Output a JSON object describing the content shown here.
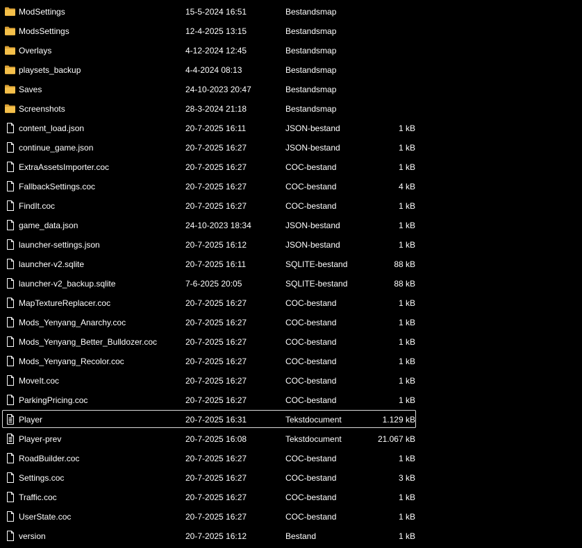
{
  "files": [
    {
      "name": "ModSettings",
      "date": "15-5-2024 16:51",
      "type": "Bestandsmap",
      "size": "",
      "icon": "folder-icon",
      "selected": false
    },
    {
      "name": "ModsSettings",
      "date": "12-4-2025 13:15",
      "type": "Bestandsmap",
      "size": "",
      "icon": "folder-icon",
      "selected": false
    },
    {
      "name": "Overlays",
      "date": "4-12-2024 12:45",
      "type": "Bestandsmap",
      "size": "",
      "icon": "folder-icon",
      "selected": false
    },
    {
      "name": "playsets_backup",
      "date": "4-4-2024 08:13",
      "type": "Bestandsmap",
      "size": "",
      "icon": "folder-icon",
      "selected": false
    },
    {
      "name": "Saves",
      "date": "24-10-2023 20:47",
      "type": "Bestandsmap",
      "size": "",
      "icon": "folder-icon",
      "selected": false
    },
    {
      "name": "Screenshots",
      "date": "28-3-2024 21:18",
      "type": "Bestandsmap",
      "size": "",
      "icon": "folder-icon",
      "selected": false
    },
    {
      "name": "content_load.json",
      "date": "20-7-2025 16:11",
      "type": "JSON-bestand",
      "size": "1 kB",
      "icon": "file-icon",
      "selected": false
    },
    {
      "name": "continue_game.json",
      "date": "20-7-2025 16:27",
      "type": "JSON-bestand",
      "size": "1 kB",
      "icon": "file-icon",
      "selected": false
    },
    {
      "name": "ExtraAssetsImporter.coc",
      "date": "20-7-2025 16:27",
      "type": "COC-bestand",
      "size": "1 kB",
      "icon": "file-icon",
      "selected": false
    },
    {
      "name": "FallbackSettings.coc",
      "date": "20-7-2025 16:27",
      "type": "COC-bestand",
      "size": "4 kB",
      "icon": "file-icon",
      "selected": false
    },
    {
      "name": "FindIt.coc",
      "date": "20-7-2025 16:27",
      "type": "COC-bestand",
      "size": "1 kB",
      "icon": "file-icon",
      "selected": false
    },
    {
      "name": "game_data.json",
      "date": "24-10-2023 18:34",
      "type": "JSON-bestand",
      "size": "1 kB",
      "icon": "file-icon",
      "selected": false
    },
    {
      "name": "launcher-settings.json",
      "date": "20-7-2025 16:12",
      "type": "JSON-bestand",
      "size": "1 kB",
      "icon": "file-icon",
      "selected": false
    },
    {
      "name": "launcher-v2.sqlite",
      "date": "20-7-2025 16:11",
      "type": "SQLITE-bestand",
      "size": "88 kB",
      "icon": "file-icon",
      "selected": false
    },
    {
      "name": "launcher-v2_backup.sqlite",
      "date": "7-6-2025 20:05",
      "type": "SQLITE-bestand",
      "size": "88 kB",
      "icon": "file-icon",
      "selected": false
    },
    {
      "name": "MapTextureReplacer.coc",
      "date": "20-7-2025 16:27",
      "type": "COC-bestand",
      "size": "1 kB",
      "icon": "file-icon",
      "selected": false
    },
    {
      "name": "Mods_Yenyang_Anarchy.coc",
      "date": "20-7-2025 16:27",
      "type": "COC-bestand",
      "size": "1 kB",
      "icon": "file-icon",
      "selected": false
    },
    {
      "name": "Mods_Yenyang_Better_Bulldozer.coc",
      "date": "20-7-2025 16:27",
      "type": "COC-bestand",
      "size": "1 kB",
      "icon": "file-icon",
      "selected": false
    },
    {
      "name": "Mods_Yenyang_Recolor.coc",
      "date": "20-7-2025 16:27",
      "type": "COC-bestand",
      "size": "1 kB",
      "icon": "file-icon",
      "selected": false
    },
    {
      "name": "MoveIt.coc",
      "date": "20-7-2025 16:27",
      "type": "COC-bestand",
      "size": "1 kB",
      "icon": "file-icon",
      "selected": false
    },
    {
      "name": "ParkingPricing.coc",
      "date": "20-7-2025 16:27",
      "type": "COC-bestand",
      "size": "1 kB",
      "icon": "file-icon",
      "selected": false
    },
    {
      "name": "Player",
      "date": "20-7-2025 16:31",
      "type": "Tekstdocument",
      "size": "1.129 kB",
      "icon": "text-document-icon",
      "selected": true
    },
    {
      "name": "Player-prev",
      "date": "20-7-2025 16:08",
      "type": "Tekstdocument",
      "size": "21.067 kB",
      "icon": "text-document-icon",
      "selected": false
    },
    {
      "name": "RoadBuilder.coc",
      "date": "20-7-2025 16:27",
      "type": "COC-bestand",
      "size": "1 kB",
      "icon": "file-icon",
      "selected": false
    },
    {
      "name": "Settings.coc",
      "date": "20-7-2025 16:27",
      "type": "COC-bestand",
      "size": "3 kB",
      "icon": "file-icon",
      "selected": false
    },
    {
      "name": "Traffic.coc",
      "date": "20-7-2025 16:27",
      "type": "COC-bestand",
      "size": "1 kB",
      "icon": "file-icon",
      "selected": false
    },
    {
      "name": "UserState.coc",
      "date": "20-7-2025 16:27",
      "type": "COC-bestand",
      "size": "1 kB",
      "icon": "file-icon",
      "selected": false
    },
    {
      "name": "version",
      "date": "20-7-2025 16:12",
      "type": "Bestand",
      "size": "1 kB",
      "icon": "file-icon",
      "selected": false
    }
  ],
  "colors": {
    "background": "#000000",
    "text": "#ffffff",
    "folder": "#f5c04a",
    "selection_border": "#dcdcdc"
  }
}
